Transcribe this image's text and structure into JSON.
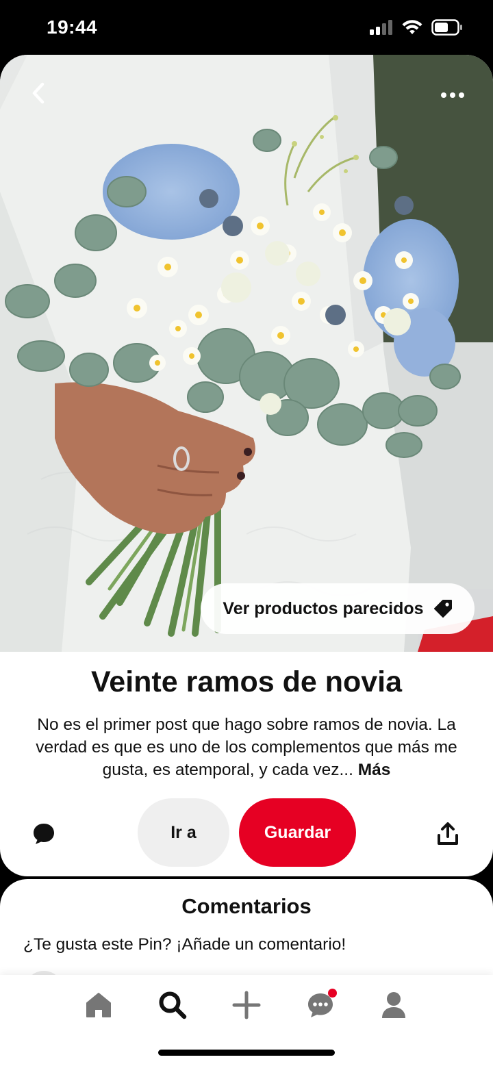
{
  "status_bar": {
    "time": "19:44"
  },
  "pin": {
    "similar_products_label": "Ver productos parecidos",
    "title": "Veinte ramos de novia",
    "description": "No es el primer post que hago sobre ramos de novia. La verdad es que es uno de los complementos que más me gusta, es atemporal, y cada vez...",
    "more_label": "Más",
    "visit_label": "Ir a",
    "save_label": "Guardar"
  },
  "comments": {
    "title": "Comentarios",
    "prompt": "¿Te gusta este Pin? ¡Añade un comentario!"
  },
  "colors": {
    "brand_red": "#e60023",
    "visit_bg": "#efefef",
    "text": "#111111"
  },
  "icons": {
    "back": "chevron-left-icon",
    "more": "more-horizontal-icon",
    "tag": "tag-icon",
    "comment": "speech-bubble-icon",
    "share": "share-icon",
    "nav": [
      "home-icon",
      "search-icon",
      "plus-icon",
      "chat-icon",
      "profile-icon"
    ]
  },
  "bottom_nav": {
    "active": "search",
    "chat_has_notification": true
  }
}
